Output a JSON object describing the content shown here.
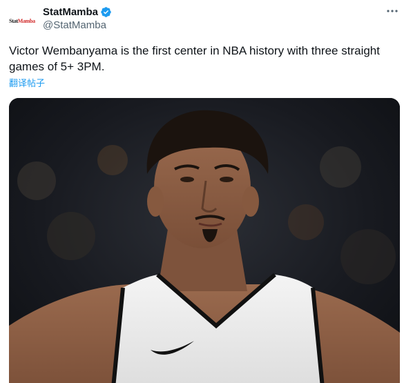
{
  "tweet": {
    "avatar_logo": {
      "part1": "Stat",
      "part2": "Mamba"
    },
    "display_name": "StatMamba",
    "handle": "@StatMamba",
    "verified": true,
    "text": "Victor Wembanyama is the first center in NBA history with three straight games of 5+ 3PM.",
    "translate_label": "翻译帖子",
    "more_icon": "more-horizontal-icon",
    "media": {
      "type": "photo"
    }
  },
  "colors": {
    "brand_blue": "#1d9bf0",
    "text_primary": "#0f1419",
    "text_secondary": "#536471"
  }
}
